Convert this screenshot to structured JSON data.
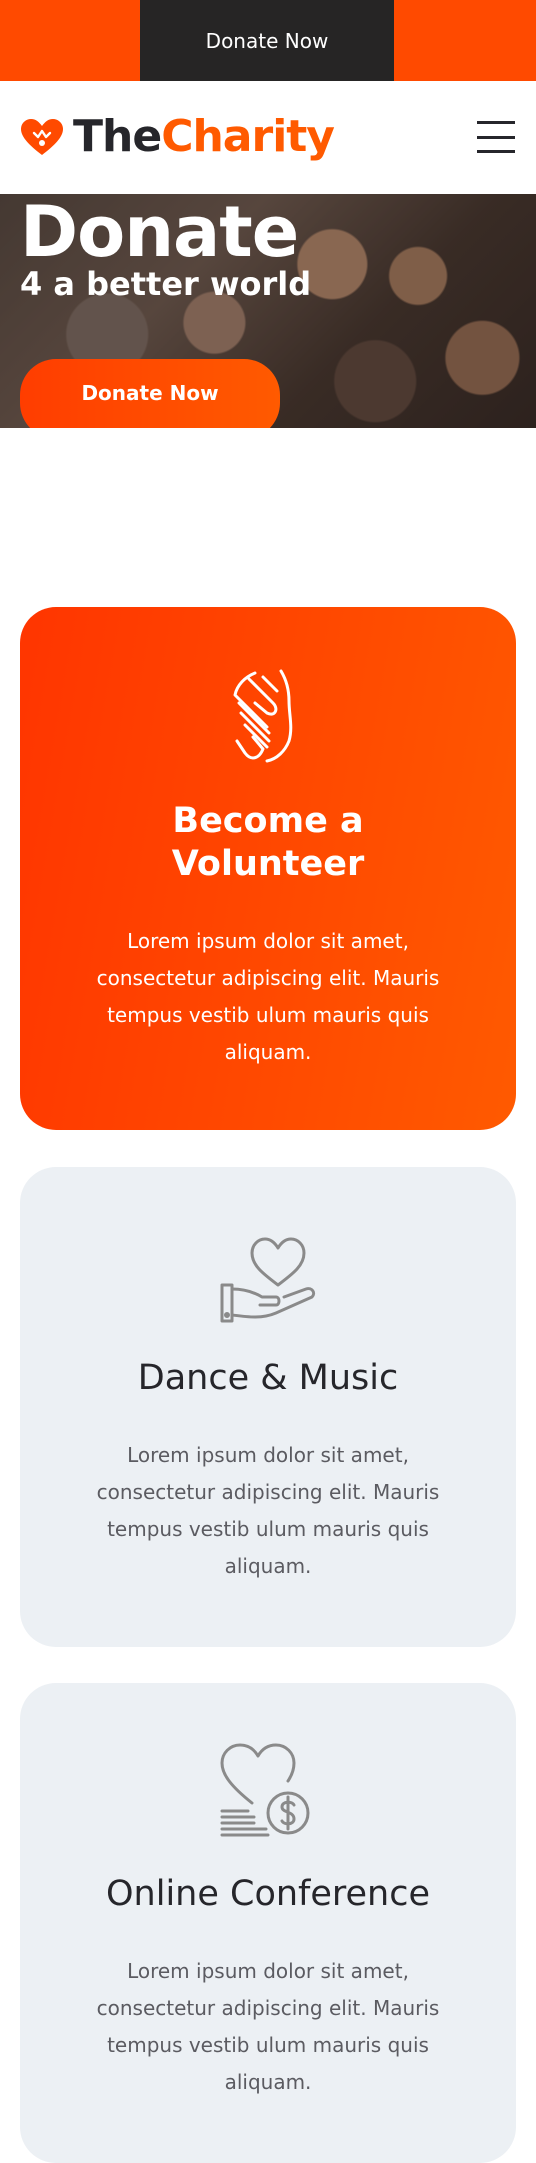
{
  "topbar": {
    "donate_label": "Donate Now"
  },
  "header": {
    "brand_the": "The",
    "brand_charity": "Charity"
  },
  "hero": {
    "title": "Donate",
    "subtitle": "4 a better world",
    "button_label": "Donate Now"
  },
  "cards": [
    {
      "title": "Become a Volunteer",
      "text": "Lorem ipsum dolor sit amet, consectetur adipiscing elit. Mauris tempus vestib ulum mauris quis aliquam.",
      "icon": "handshake-icon"
    },
    {
      "title": "Dance & Music",
      "text": "Lorem ipsum dolor sit amet, consectetur adipiscing elit. Mauris tempus vestib ulum mauris quis aliquam.",
      "icon": "heart-in-hand-icon"
    },
    {
      "title": "Online Conference",
      "text": "Lorem ipsum dolor sit amet, consectetur adipiscing elit. Mauris tempus vestib ulum mauris quis aliquam.",
      "icon": "heart-coins-icon"
    }
  ],
  "colors": {
    "accent": "#ff4a00",
    "dark": "#262525",
    "card_grey": "#ecf0f4"
  }
}
